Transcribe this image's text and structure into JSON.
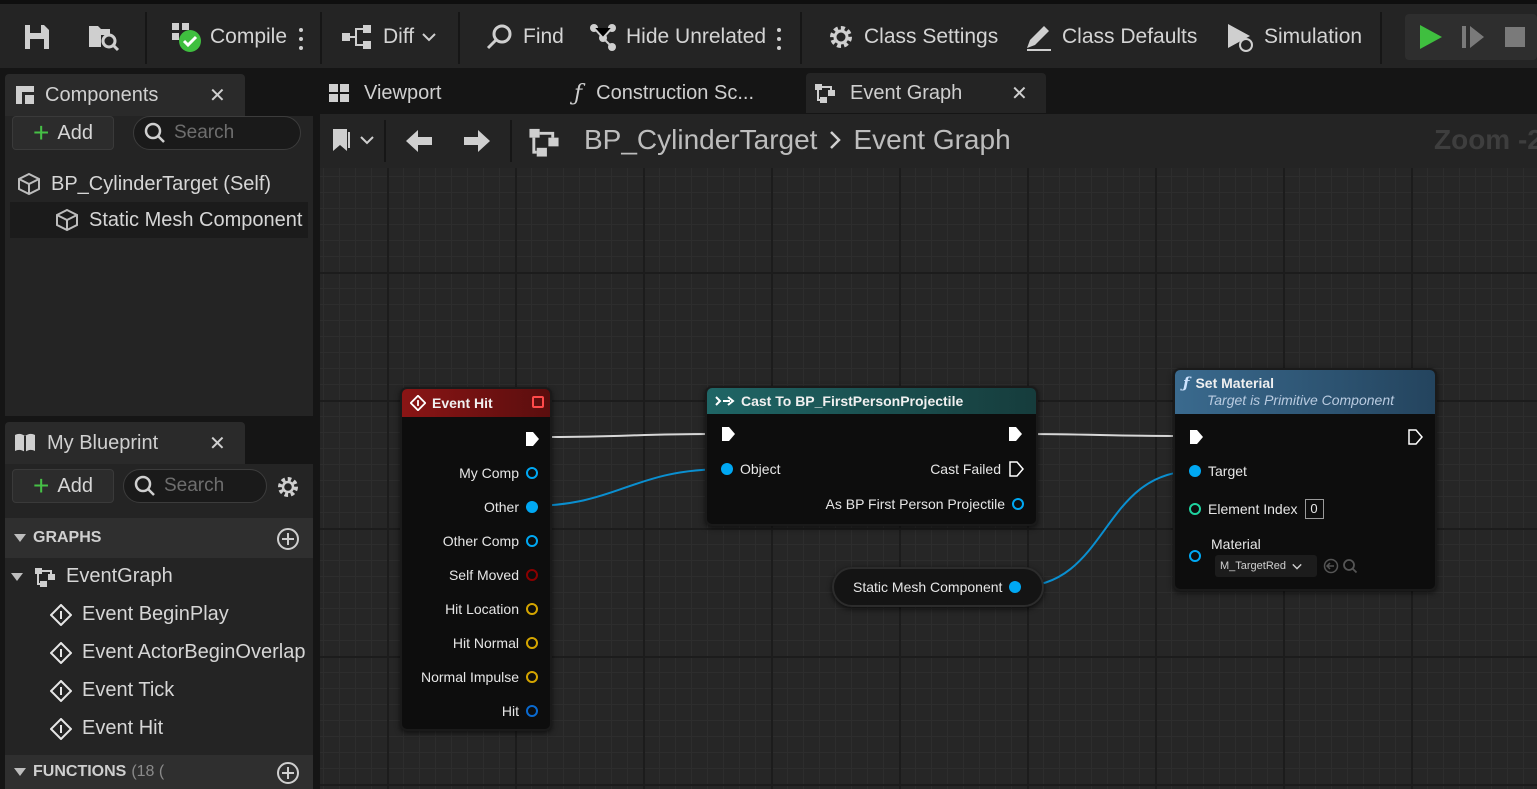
{
  "toolbar": {
    "compile": "Compile",
    "diff": "Diff",
    "find": "Find",
    "hide_unrelated": "Hide Unrelated",
    "class_settings": "Class Settings",
    "class_defaults": "Class Defaults",
    "simulation": "Simulation"
  },
  "components_panel": {
    "title": "Components",
    "add_label": "Add",
    "search_placeholder": "Search",
    "items": [
      "BP_CylinderTarget (Self)",
      "Static Mesh Component"
    ]
  },
  "my_blueprint": {
    "title": "My Blueprint",
    "add_label": "Add",
    "search_placeholder": "Search",
    "graphs_label": "GRAPHS",
    "graph_name": "EventGraph",
    "events": [
      "Event BeginPlay",
      "Event ActorBeginOverlap",
      "Event Tick",
      "Event Hit"
    ],
    "functions_label": "FUNCTIONS",
    "functions_count": "(18 (",
    "selected_component_row": "Static Mesh Component"
  },
  "tabs": [
    "Viewport",
    "Construction Sc...",
    "Event Graph"
  ],
  "breadcrumb": {
    "blueprint": "BP_CylinderTarget",
    "graph": "Event Graph",
    "zoom": "Zoom -2"
  },
  "nodes": {
    "event_hit": {
      "title": "Event Hit",
      "pins": [
        "My Comp",
        "Other",
        "Other Comp",
        "Self Moved",
        "Hit Location",
        "Hit Normal",
        "Normal Impulse",
        "Hit"
      ]
    },
    "cast": {
      "title": "Cast To BP_FirstPersonProjectile",
      "object_pin": "Object",
      "cast_failed": "Cast Failed",
      "as_pin": "As BP First Person Projectile"
    },
    "static_mesh": {
      "label": "Static Mesh Component"
    },
    "set_material": {
      "title": "Set Material",
      "subtitle": "Target is Primitive Component",
      "target_pin": "Target",
      "element_index_label": "Element Index",
      "element_index_value": "0",
      "material_label": "Material",
      "material_value": "M_TargetRed"
    }
  },
  "colors": {
    "event_header": "#7a1414",
    "cast_header": "#1f5a5a",
    "function_header": "#2f5a7c",
    "object_pin": "#00a8f3",
    "struct_pin": "#d4a500",
    "bool_pin": "#8a0000",
    "int_pin": "#1fd3a0",
    "play_green": "#3fbf3f"
  }
}
